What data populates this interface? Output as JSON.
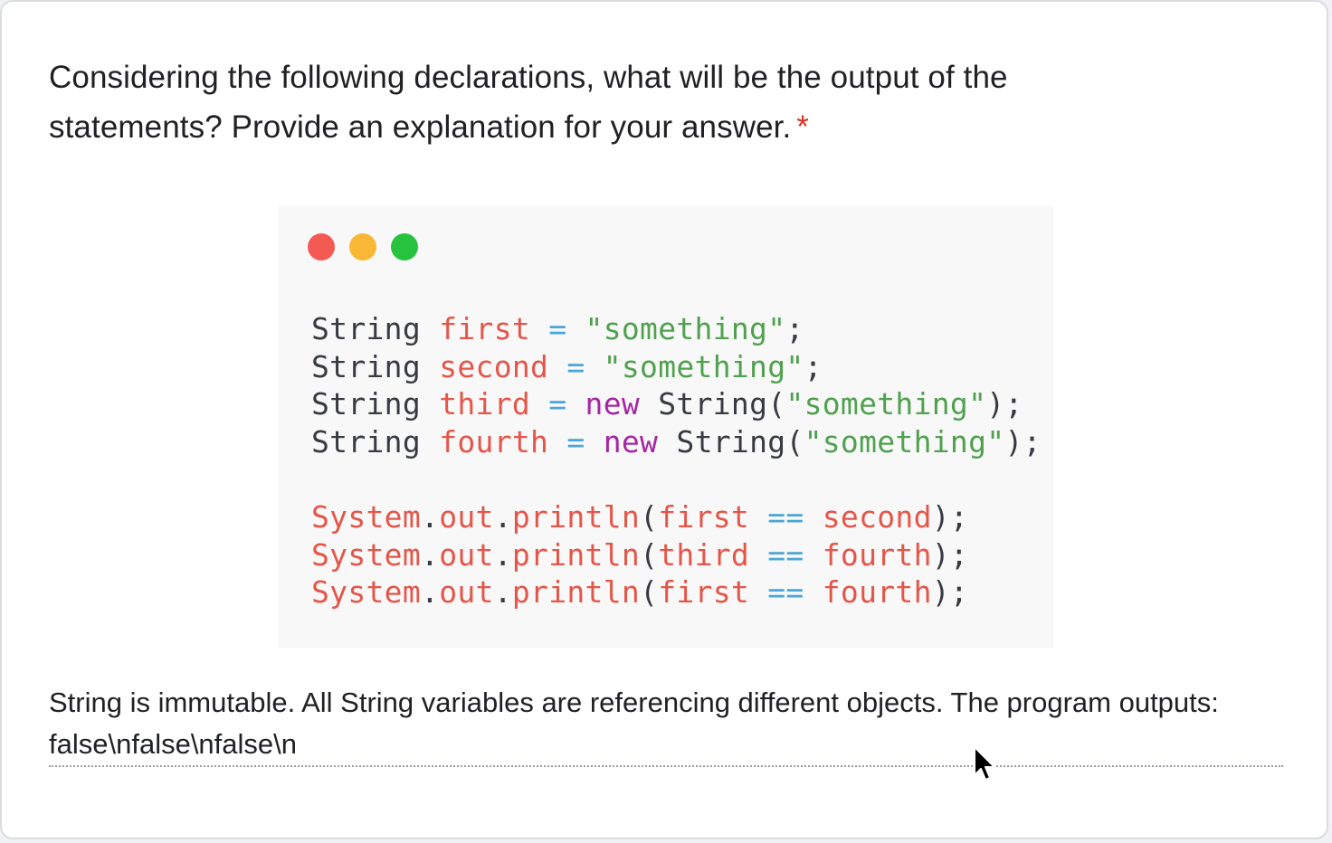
{
  "question": {
    "text": "Considering the following declarations, what will be the output of the statements? Provide an explanation for your answer.",
    "required_marker": "*"
  },
  "code_image": {
    "window_dots": [
      {
        "name": "close",
        "color": "#f25a52"
      },
      {
        "name": "minimize",
        "color": "#f9b736"
      },
      {
        "name": "maximize",
        "color": "#27c23e"
      }
    ],
    "lines": [
      [
        {
          "t": "String ",
          "c": "plain"
        },
        {
          "t": "first",
          "c": "var"
        },
        {
          "t": " = ",
          "c": "op"
        },
        {
          "t": "\"something\"",
          "c": "str"
        },
        {
          "t": ";",
          "c": "plain"
        }
      ],
      [
        {
          "t": "String ",
          "c": "plain"
        },
        {
          "t": "second",
          "c": "var"
        },
        {
          "t": " = ",
          "c": "op"
        },
        {
          "t": "\"something\"",
          "c": "str"
        },
        {
          "t": ";",
          "c": "plain"
        }
      ],
      [
        {
          "t": "String ",
          "c": "plain"
        },
        {
          "t": "third",
          "c": "var"
        },
        {
          "t": " = ",
          "c": "op"
        },
        {
          "t": "new",
          "c": "kw"
        },
        {
          "t": " String(",
          "c": "plain"
        },
        {
          "t": "\"something\"",
          "c": "str"
        },
        {
          "t": ");",
          "c": "plain"
        }
      ],
      [
        {
          "t": "String ",
          "c": "plain"
        },
        {
          "t": "fourth",
          "c": "var"
        },
        {
          "t": " = ",
          "c": "op"
        },
        {
          "t": "new",
          "c": "kw"
        },
        {
          "t": " String(",
          "c": "plain"
        },
        {
          "t": "\"something\"",
          "c": "str"
        },
        {
          "t": ");",
          "c": "plain"
        }
      ],
      [],
      [
        {
          "t": "System",
          "c": "var"
        },
        {
          "t": ".",
          "c": "plain"
        },
        {
          "t": "out",
          "c": "var"
        },
        {
          "t": ".",
          "c": "plain"
        },
        {
          "t": "println",
          "c": "var"
        },
        {
          "t": "(",
          "c": "plain"
        },
        {
          "t": "first",
          "c": "var"
        },
        {
          "t": " == ",
          "c": "op"
        },
        {
          "t": "second",
          "c": "var"
        },
        {
          "t": ");",
          "c": "plain"
        }
      ],
      [
        {
          "t": "System",
          "c": "var"
        },
        {
          "t": ".",
          "c": "plain"
        },
        {
          "t": "out",
          "c": "var"
        },
        {
          "t": ".",
          "c": "plain"
        },
        {
          "t": "println",
          "c": "var"
        },
        {
          "t": "(",
          "c": "plain"
        },
        {
          "t": "third",
          "c": "var"
        },
        {
          "t": " == ",
          "c": "op"
        },
        {
          "t": "fourth",
          "c": "var"
        },
        {
          "t": ");",
          "c": "plain"
        }
      ],
      [
        {
          "t": "System",
          "c": "var"
        },
        {
          "t": ".",
          "c": "plain"
        },
        {
          "t": "out",
          "c": "var"
        },
        {
          "t": ".",
          "c": "plain"
        },
        {
          "t": "println",
          "c": "var"
        },
        {
          "t": "(",
          "c": "plain"
        },
        {
          "t": "first",
          "c": "var"
        },
        {
          "t": " == ",
          "c": "op"
        },
        {
          "t": "fourth",
          "c": "var"
        },
        {
          "t": ");",
          "c": "plain"
        }
      ]
    ]
  },
  "answer": {
    "value": "String is immutable. All String variables are referencing different objects. The program outputs: false\\nfalse\\nfalse\\n"
  },
  "icons": {
    "cursor": "mouse-pointer-icon"
  }
}
